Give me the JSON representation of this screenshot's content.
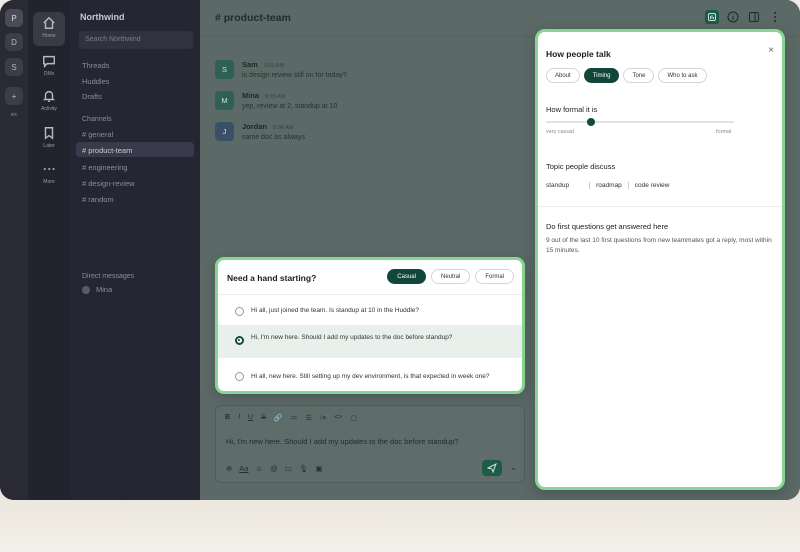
{
  "workspaces": [
    {
      "label": "P",
      "active": true
    },
    {
      "label": "D",
      "active": false
    },
    {
      "label": "S",
      "active": false
    },
    {
      "label": "+",
      "active": false
    }
  ],
  "rail_more_label": "etc",
  "nav": [
    {
      "label": "Home",
      "icon": "home-icon"
    },
    {
      "label": "DMs",
      "icon": "dm-icon"
    },
    {
      "label": "Activity",
      "icon": "bell-icon"
    },
    {
      "label": "Later",
      "icon": "bookmark-icon"
    },
    {
      "label": "More",
      "icon": "more-icon"
    }
  ],
  "sidebar": {
    "workspace_name": "Northwind",
    "search_placeholder": "Search Northwind",
    "items": [
      "Threads",
      "Huddles",
      "Drafts"
    ],
    "channels_header": "Channels",
    "channels": [
      "# general",
      "# product-team",
      "# engineering",
      "# design-review",
      "# random"
    ],
    "active_channel_index": 1,
    "dm_header": "Direct messages",
    "dm_user": "Mina"
  },
  "channel": {
    "title": "# product-team",
    "header_icons": [
      "insights-icon",
      "info-icon",
      "split-view-icon",
      "kebab-menu-icon"
    ]
  },
  "messages": [
    {
      "initial": "S",
      "name": "Sam",
      "time": "9:02 AM",
      "text": "is design review still on for today?"
    },
    {
      "initial": "M",
      "name": "Mina",
      "time": "9:05 AM",
      "text": "yep, review at 2, standup at 10"
    },
    {
      "initial": "J",
      "name": "Jordan",
      "time": "9:06 AM",
      "text": "same doc as always"
    }
  ],
  "composer": {
    "format_buttons": [
      "B",
      "I",
      "U",
      "S",
      "🔗",
      "≔",
      "☰",
      "⁝≡",
      "<>",
      "▢"
    ],
    "text": "Hi, I'm new here. Should I add my updates to the doc before standup?",
    "tools": [
      "⊕",
      "Aa",
      "☺",
      "@",
      "▭",
      "🎙",
      "▣"
    ]
  },
  "popup": {
    "title": "Need a hand starting?",
    "tones": [
      "Casual",
      "Neutral",
      "Formal"
    ],
    "active_tone": 0,
    "options": [
      "Hi all, just joined the team. Is standup at 10 in the Huddle?",
      "Hi, I'm new here. Should I add my updates to the doc before standup?",
      "Hi all, new here. Still setting up my dev environment, is that expected in week one?"
    ],
    "selected_option": 1
  },
  "panel": {
    "title": "How people talk",
    "close_label": "×",
    "tabs": [
      "About",
      "Timing",
      "Tone",
      "Who to ask"
    ],
    "active_tab": 1,
    "formality_title": "How formal it is",
    "formality_level": 0.24,
    "formality_min_label": "very casual",
    "formality_max_label": "formal",
    "topics_title": "Topic people discuss",
    "topics": [
      "standup",
      "roadmap",
      "code review"
    ],
    "answer_title": "Do first questions get answered here",
    "answer_text": "9 out of the last 10 first questions from new teammates got a reply, most within 15 minutes."
  },
  "colors": {
    "accent": "#11473a",
    "highlight_border": "#86d691",
    "sidebar_bg": "#252533",
    "main_dimmed": "#5c6a67"
  }
}
